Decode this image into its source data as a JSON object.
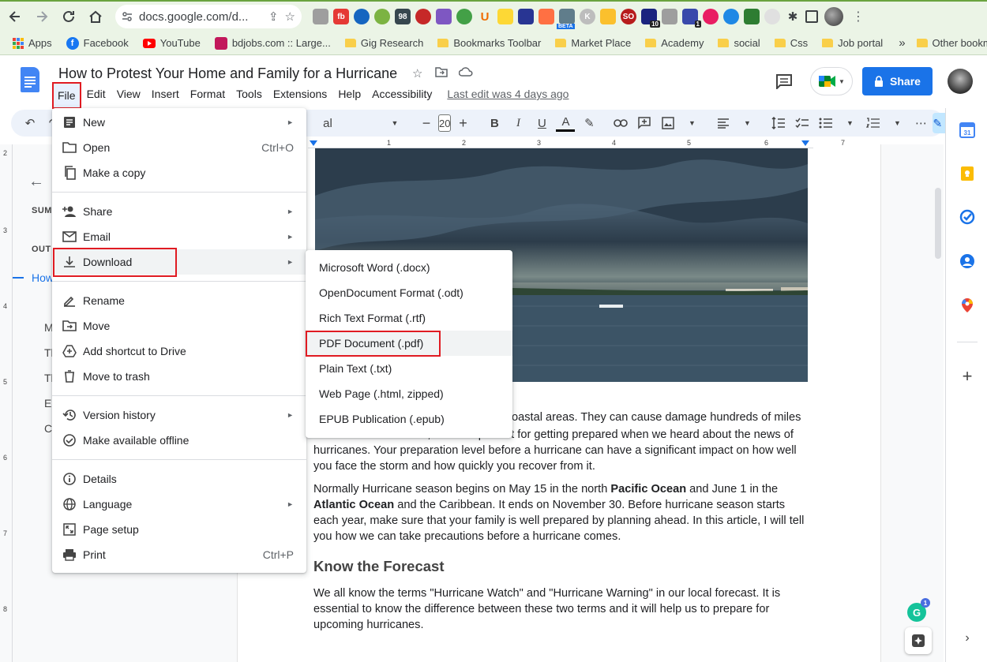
{
  "browser": {
    "url": "docs.google.com/d...",
    "extension_labels": {
      "fb": "fb",
      "u": "U",
      "ge": "98",
      "badge10": "10",
      "badge1": "1",
      "beta": "BETA",
      "k": "K",
      "so": "SO"
    },
    "bookmarks": [
      {
        "label": "Apps",
        "icon": "apps-grid-icon"
      },
      {
        "label": "Facebook",
        "icon": "facebook-icon"
      },
      {
        "label": "YouTube",
        "icon": "youtube-icon"
      },
      {
        "label": "bdjobs.com :: Large...",
        "icon": "bdjobs-icon"
      },
      {
        "label": "Gig Research",
        "icon": "folder-icon"
      },
      {
        "label": "Bookmarks Toolbar",
        "icon": "folder-icon"
      },
      {
        "label": "Market Place",
        "icon": "folder-icon"
      },
      {
        "label": "Academy",
        "icon": "folder-icon"
      },
      {
        "label": "social",
        "icon": "folder-icon"
      },
      {
        "label": "Css",
        "icon": "folder-icon"
      },
      {
        "label": "Job portal",
        "icon": "folder-icon"
      }
    ],
    "more_bookmarks": "»",
    "other_bookmarks": "Other bookmarks"
  },
  "docs": {
    "title": "How to Protest Your Home and Family for a Hurricane",
    "menu": [
      "File",
      "Edit",
      "View",
      "Insert",
      "Format",
      "Tools",
      "Extensions",
      "Help",
      "Accessibility"
    ],
    "last_edit": "Last edit was 4 days ago",
    "share_label": "Share",
    "brand_color": "#1a73e8"
  },
  "toolbar": {
    "font_name_fragment": "al",
    "font_size": "20",
    "minus": "−",
    "plus": "+",
    "bold": "B",
    "italic": "I",
    "underline": "U",
    "text_color": "A",
    "more": "⋯"
  },
  "outline": {
    "summary_label": "SUM",
    "outline_label": "OUT",
    "items": [
      "How",
      "M",
      "Tl",
      "Tl",
      "E",
      "C"
    ]
  },
  "ruler": {
    "h_ticks": [
      "1",
      "2",
      "3",
      "4",
      "5",
      "6",
      "7"
    ],
    "v_ticks": [
      "2",
      "3",
      "4",
      "5",
      "6",
      "7",
      "8"
    ]
  },
  "file_menu": {
    "items": [
      {
        "label": "New",
        "icon": "new-doc-icon",
        "submenu": true
      },
      {
        "label": "Open",
        "icon": "folder-open-icon",
        "shortcut": "Ctrl+O"
      },
      {
        "label": "Make a copy",
        "icon": "copy-icon"
      },
      {
        "label": "Share",
        "icon": "person-add-icon",
        "submenu": true
      },
      {
        "label": "Email",
        "icon": "email-icon",
        "submenu": true
      },
      {
        "label": "Download",
        "icon": "download-icon",
        "submenu": true
      },
      {
        "label": "Rename",
        "icon": "rename-icon"
      },
      {
        "label": "Move",
        "icon": "move-icon"
      },
      {
        "label": "Add shortcut to Drive",
        "icon": "drive-shortcut-icon"
      },
      {
        "label": "Move to trash",
        "icon": "trash-icon"
      },
      {
        "label": "Version history",
        "icon": "history-icon",
        "submenu": true
      },
      {
        "label": "Make available offline",
        "icon": "offline-icon"
      },
      {
        "label": "Details",
        "icon": "info-icon"
      },
      {
        "label": "Language",
        "icon": "globe-icon",
        "submenu": true
      },
      {
        "label": "Page setup",
        "icon": "page-setup-icon"
      },
      {
        "label": "Print",
        "icon": "print-icon",
        "shortcut": "Ctrl+P"
      }
    ],
    "submenu_arrow": "►"
  },
  "download_menu": {
    "items": [
      "Microsoft Word (.docx)",
      "OpenDocument Format (.odt)",
      "Rich Text Format (.rtf)",
      "PDF Document (.pdf)",
      "Plain Text (.txt)",
      "Web Page (.html, zipped)",
      "EPUB Publication (.epub)"
    ]
  },
  "document": {
    "p1_line1_tail": "oastal areas. They can cause damage hundreds of miles",
    "p1_line2": "from the shore. Hence, it's so important for getting prepared when we heard about the news of",
    "p1_line3": "hurricanes. Your preparation level before a hurricane can have a significant impact on how well",
    "p1_line4": "you face the storm and how quickly you recover from it.",
    "p2_a": "Normally Hurricane season begins on May 15 in the north ",
    "p2_b": "Pacific Ocean",
    "p2_c": " and June 1 in the ",
    "p2_d": "Atlantic Ocean",
    "p2_e": " and the Caribbean. It ends on November 30. Before hurricane season starts each year, make sure that your family is well prepared by planning ahead. In this article, I will tell you how we can take precautions before a hurricane comes.",
    "heading": "Know the Forecast",
    "p3": "We all know the terms \"Hurricane Watch\" and \"Hurricane Warning\" in our local forecast. It is essential to know the difference between these two terms and it will help us to prepare for upcoming hurricanes."
  },
  "grammarly_badge": "1",
  "grammarly_letter": "G"
}
